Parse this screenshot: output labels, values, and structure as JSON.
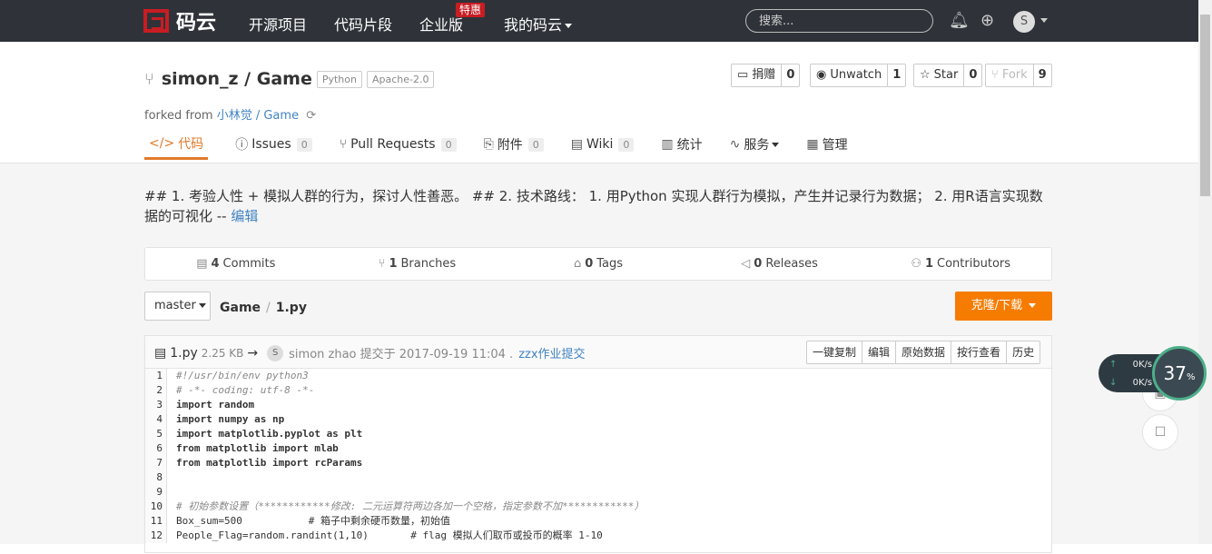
{
  "nav": {
    "logo_text": "码云",
    "items": [
      "开源项目",
      "代码片段",
      "企业版",
      "我的码云"
    ],
    "hot_badge": "特惠",
    "search_placeholder": "搜索...",
    "avatar_letter": "S"
  },
  "repo": {
    "title": "simon_z / Game",
    "tags": [
      "Python",
      "Apache-2.0"
    ],
    "forked_label": "forked from",
    "forked_source": "小林觉 / Game",
    "actions": [
      {
        "label": "捐赠",
        "count": "0"
      },
      {
        "label": "Unwatch",
        "count": "1"
      },
      {
        "label": "Star",
        "count": "0"
      },
      {
        "label": "Fork",
        "count": "9"
      }
    ],
    "tabs": [
      {
        "label": "代码",
        "count": ""
      },
      {
        "label": "Issues",
        "count": "0"
      },
      {
        "label": "Pull Requests",
        "count": "0"
      },
      {
        "label": "附件",
        "count": "0"
      },
      {
        "label": "Wiki",
        "count": "0"
      },
      {
        "label": "统计",
        "count": ""
      },
      {
        "label": "服务",
        "count": ""
      },
      {
        "label": "管理",
        "count": ""
      }
    ]
  },
  "description": {
    "text": "## 1. 考验人性 + 模拟人群的行为，探讨人性善恶。 ## 2. 技术路线： 1. 用Python 实现人群行为模拟，产生并记录行为数据； 2. 用R语言实现数据的可视化 --",
    "edit_link": "编辑"
  },
  "stats": [
    {
      "count": "4",
      "label": "Commits"
    },
    {
      "count": "1",
      "label": "Branches"
    },
    {
      "count": "0",
      "label": "Tags"
    },
    {
      "count": "0",
      "label": "Releases"
    },
    {
      "count": "1",
      "label": "Contributors"
    }
  ],
  "branch": "master",
  "breadcrumb": {
    "repo": "Game",
    "file": "1.py"
  },
  "clone_button": "克隆/下载",
  "file": {
    "name": "1.py",
    "size": "2.25 KB",
    "arrow": "→",
    "avatar_letter": "S",
    "committer": "simon zhao 提交于 2017-09-19 11:04 .",
    "message": "zzx作业提交",
    "actions": [
      "一键复制",
      "编辑",
      "原始数据",
      "按行查看",
      "历史"
    ]
  },
  "code_lines": [
    {
      "n": "1",
      "text": "#!/usr/bin/env python3",
      "type": "comment"
    },
    {
      "n": "2",
      "text": "# -*- coding: utf-8 -*-",
      "type": "comment"
    },
    {
      "n": "3",
      "text": "import random",
      "type": "kw"
    },
    {
      "n": "4",
      "text": "import numpy as np",
      "type": "kw"
    },
    {
      "n": "5",
      "text": "import matplotlib.pyplot as plt",
      "type": "kw"
    },
    {
      "n": "6",
      "text": "from matplotlib import mlab",
      "type": "kw"
    },
    {
      "n": "7",
      "text": "from matplotlib import rcParams",
      "type": "kw"
    },
    {
      "n": "8",
      "text": "",
      "type": "plain"
    },
    {
      "n": "9",
      "text": "",
      "type": "plain"
    },
    {
      "n": "10",
      "text": "# 初始参数设置（************修改: 二元运算符两边各加一个空格，指定参数不加************）",
      "type": "comment"
    },
    {
      "n": "11",
      "text": "Box_sum=500           # 箱子中剩余硬币数量，初始值",
      "type": "plain"
    },
    {
      "n": "12",
      "text": "People_Flag=random.randint(1,10)       # flag 模拟人们取币或投币的概率 1-10",
      "type": "plain"
    }
  ],
  "speed": {
    "up": "0K/s",
    "down": "0K/s",
    "percent": "37"
  }
}
